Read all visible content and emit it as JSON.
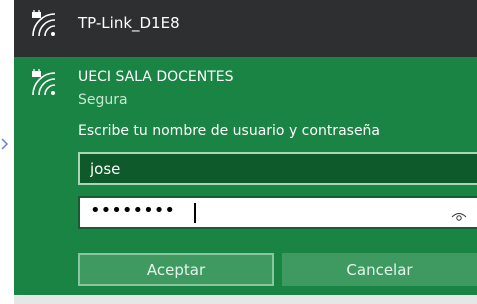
{
  "networks": [
    {
      "name": "TP-Link_D1E8",
      "icon": "wifi-secured-icon"
    },
    {
      "name": "UECI SALA DOCENTES",
      "status": "Segura",
      "icon": "wifi-secured-icon",
      "prompt": "Escribe tu nombre de usuario y contraseña",
      "username_value": "jose",
      "password_mask": "••••••••",
      "buttons": {
        "accept": "Aceptar",
        "cancel": "Cancelar"
      }
    }
  ],
  "colors": {
    "top_bg": "#2d2f30",
    "active_bg": "#198444",
    "button_bg": "#3f9a62",
    "text": "#ffffff"
  }
}
